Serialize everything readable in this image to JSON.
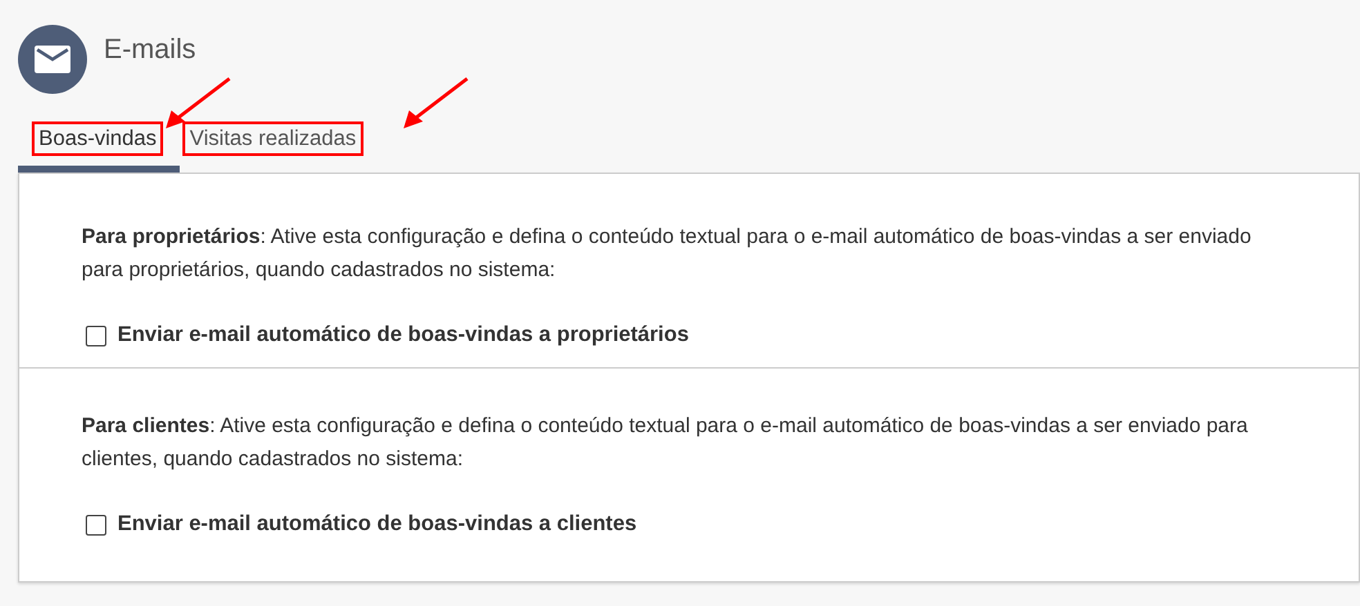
{
  "header": {
    "title": "E-mails"
  },
  "tabs": [
    {
      "label": "Boas-vindas",
      "selected": true,
      "highlighted": true
    },
    {
      "label": "Visitas realizadas",
      "selected": false,
      "highlighted": true
    }
  ],
  "sections": [
    {
      "description": "**Para proprietários**: Ative esta configuração e defina o conteúdo textual para o e-mail automático de boas-vindas a ser enviado para proprietários, quando cadastrados no sistema:",
      "checkbox_label": "Enviar e-mail automático de boas-vindas a proprietários",
      "checked": false
    },
    {
      "description": "**Para clientes**: Ative esta configuração e defina o conteúdo textual para o e-mail automático de boas-vindas a ser enviado para clientes, quando cadastrados no sistema:",
      "checkbox_label": "Enviar e-mail automático de boas-vindas a clientes",
      "checked": false
    }
  ]
}
